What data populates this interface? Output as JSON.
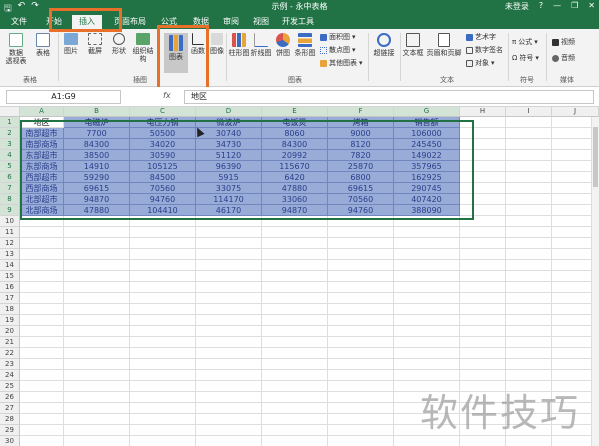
{
  "window": {
    "title": "示例 - 永中表格",
    "user": "未登录",
    "accent": "#217346"
  },
  "tabs": [
    "文件",
    "开始",
    "插入",
    "页面布局",
    "公式",
    "数据",
    "审阅",
    "视图",
    "开发工具"
  ],
  "active_tab": "插入",
  "ribbon": {
    "pivot": {
      "label1": "数据",
      "label2": "透视表"
    },
    "table": "表格",
    "group_table": "表格",
    "picture": "图片",
    "screenshot": "截屏",
    "shape": "形状",
    "smartart": "组织结构",
    "chart": "图表",
    "func_chart": "函数",
    "image": "图像",
    "group_illust": "插图",
    "column": "柱形图",
    "line": "折线图",
    "pie": "饼图",
    "bar": "条形图",
    "area": "面积图",
    "scatter": "散点图",
    "other_chart": "其他图表",
    "group_chart": "图表",
    "hyperlink": "超链接",
    "textbox": "文本框",
    "header_footer": "页眉和页脚",
    "wordart": "艺术字",
    "signature": "数字签名",
    "object": "对象",
    "group_text": "文本",
    "formula": "公式",
    "symbol_small": "符号",
    "symbol": "符号",
    "video": "视频",
    "audio": "音频",
    "group_media": "媒体"
  },
  "formula_bar": {
    "name_box": "A1:G9",
    "fx": "fx",
    "content": "地区"
  },
  "columns": [
    "A",
    "B",
    "C",
    "D",
    "E",
    "F",
    "G",
    "H",
    "I",
    "J"
  ],
  "rows": [
    "1",
    "2",
    "3",
    "4",
    "5",
    "6",
    "7",
    "8",
    "9",
    "10",
    "11",
    "12",
    "13",
    "14",
    "15",
    "16",
    "17",
    "18",
    "19",
    "20",
    "21",
    "22",
    "23",
    "24",
    "25",
    "26",
    "27",
    "28",
    "29",
    "30"
  ],
  "table": {
    "headers": [
      "地区",
      "电磁炉",
      "电压力锅",
      "微波炉",
      "电饭煲",
      "烤箱",
      "销售额"
    ],
    "rows": [
      [
        "南部超市",
        "7700",
        "50500",
        "30740",
        "8060",
        "9000",
        "106000"
      ],
      [
        "南部商场",
        "84300",
        "34020",
        "34730",
        "84300",
        "8120",
        "245450"
      ],
      [
        "东部超市",
        "38500",
        "30590",
        "51120",
        "20992",
        "7820",
        "149022"
      ],
      [
        "东部商场",
        "14910",
        "105125",
        "96390",
        "115670",
        "25870",
        "357965"
      ],
      [
        "西部超市",
        "59290",
        "84500",
        "5915",
        "6420",
        "6800",
        "162925"
      ],
      [
        "西部商场",
        "69615",
        "70560",
        "33075",
        "47880",
        "69615",
        "290745"
      ],
      [
        "北部超市",
        "94870",
        "94760",
        "114170",
        "33060",
        "70560",
        "407420"
      ],
      [
        "北部商场",
        "47880",
        "104410",
        "46170",
        "94870",
        "94760",
        "388090"
      ]
    ]
  },
  "watermark": "软件技巧"
}
